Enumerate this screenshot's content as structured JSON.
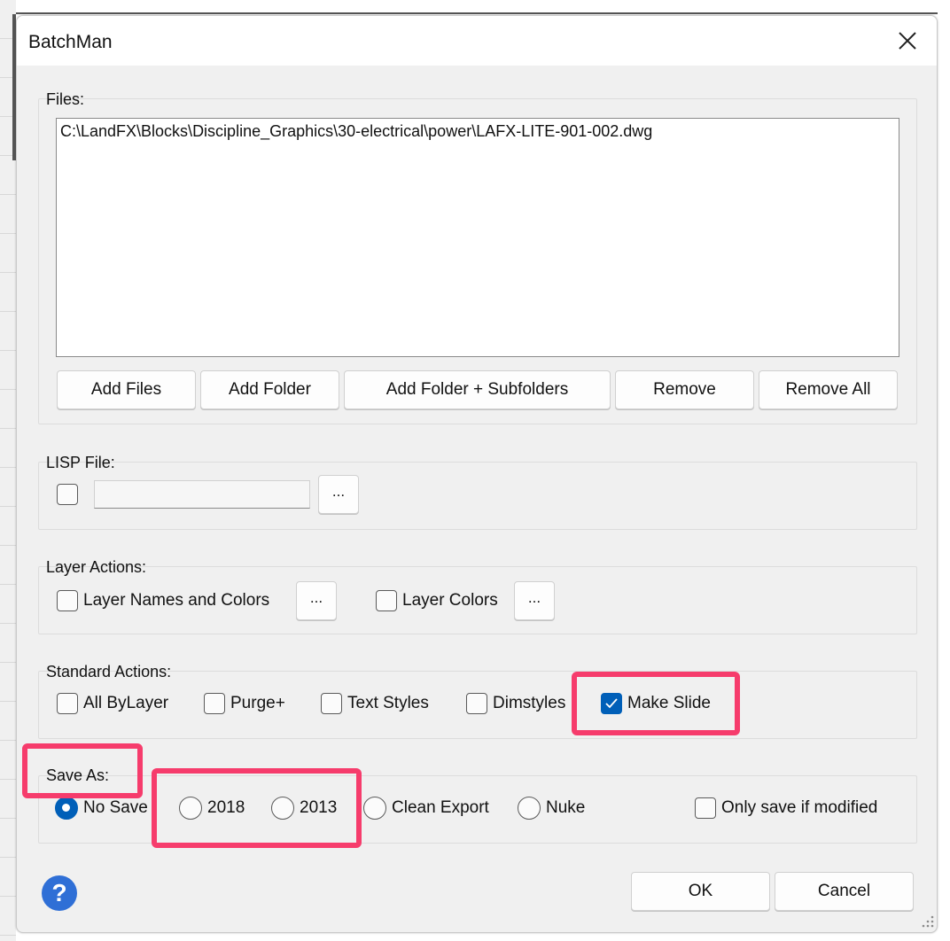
{
  "window": {
    "title": "BatchMan"
  },
  "files": {
    "label": "Files:",
    "items": [
      "C:\\LandFX\\Blocks\\Discipline_Graphics\\30-electrical\\power\\LAFX-LITE-901-002.dwg"
    ],
    "buttons": {
      "add_files": "Add Files",
      "add_folder": "Add Folder",
      "add_folder_subfolders": "Add Folder + Subfolders",
      "remove": "Remove",
      "remove_all": "Remove All"
    }
  },
  "lisp": {
    "label": "LISP File:",
    "checked": false,
    "path_value": "",
    "browse": "..."
  },
  "layer_actions": {
    "label": "Layer Actions:",
    "names_and_colors": {
      "label": "Layer Names and Colors",
      "checked": false
    },
    "colors": {
      "label": "Layer Colors",
      "checked": false
    },
    "browse": "..."
  },
  "standard_actions": {
    "label": "Standard Actions:",
    "items": [
      {
        "label": "All ByLayer",
        "checked": false
      },
      {
        "label": "Purge+",
        "checked": false
      },
      {
        "label": "Text Styles",
        "checked": false
      },
      {
        "label": "Dimstyles",
        "checked": false
      },
      {
        "label": "Make Slide",
        "checked": true
      }
    ]
  },
  "save_as": {
    "label": "Save As:",
    "options": [
      {
        "label": "No Save",
        "selected": true
      },
      {
        "label": "2018",
        "selected": false
      },
      {
        "label": "2013",
        "selected": false
      },
      {
        "label": "Clean Export",
        "selected": false
      },
      {
        "label": "Nuke",
        "selected": false
      }
    ],
    "only_if_modified": {
      "label": "Only save if modified",
      "checked": false
    }
  },
  "footer": {
    "help": "?",
    "ok": "OK",
    "cancel": "Cancel"
  },
  "colors": {
    "accent": "#005fb8",
    "highlight": "#f63c6c",
    "help_icon": "#2f6fd6"
  }
}
